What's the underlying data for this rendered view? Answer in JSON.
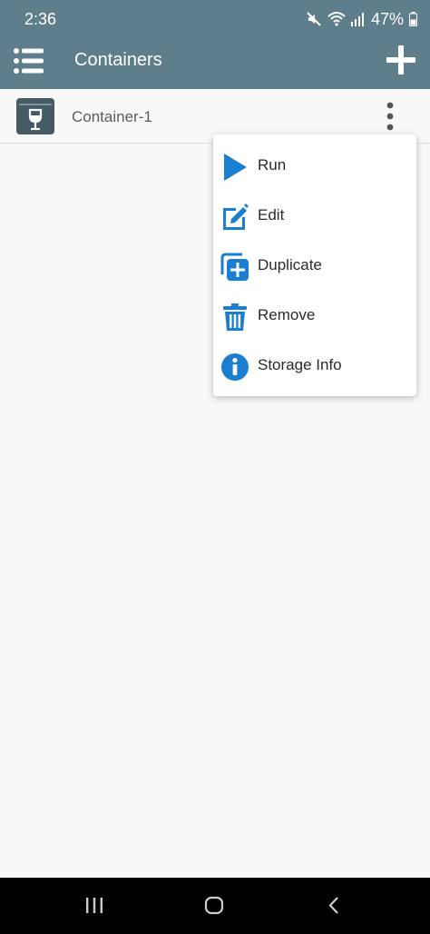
{
  "status_bar": {
    "time": "2:36",
    "battery_percent": "47%",
    "icons": [
      "mute-icon",
      "wifi-icon",
      "signal-icon",
      "battery-icon"
    ]
  },
  "app_bar": {
    "title": "Containers",
    "menu_icon": "list-menu-icon",
    "add_icon": "plus-icon"
  },
  "containers": [
    {
      "name": "Container-1",
      "icon": "wine-glass-box-icon"
    }
  ],
  "context_menu": {
    "items": [
      {
        "label": "Run",
        "icon": "play-icon"
      },
      {
        "label": "Edit",
        "icon": "edit-icon"
      },
      {
        "label": "Duplicate",
        "icon": "duplicate-icon"
      },
      {
        "label": "Remove",
        "icon": "trash-icon"
      },
      {
        "label": "Storage Info",
        "icon": "info-icon"
      }
    ]
  },
  "nav_bar": {
    "buttons": [
      "recents-icon",
      "home-icon",
      "back-icon"
    ]
  },
  "colors": {
    "app_bar": "#5f7e8b",
    "accent": "#1a7fd0",
    "background": "#f8f8f8"
  }
}
